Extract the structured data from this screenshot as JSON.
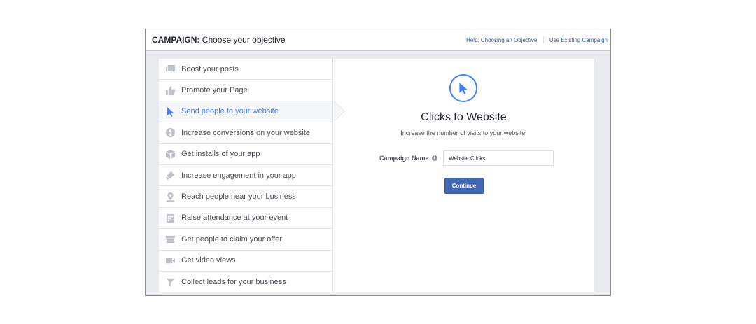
{
  "header": {
    "title_prefix": "CAMPAIGN:",
    "title_text": "Choose your objective",
    "help_link": "Help: Choosing an Objective",
    "existing_link": "Use Existing Campaign"
  },
  "objectives": [
    {
      "label": "Boost your posts",
      "icon": "posts-icon"
    },
    {
      "label": "Promote your Page",
      "icon": "thumbs-up-icon"
    },
    {
      "label": "Send people to your website",
      "icon": "cursor-icon",
      "selected": true
    },
    {
      "label": "Increase conversions on your website",
      "icon": "globe-icon"
    },
    {
      "label": "Get installs of your app",
      "icon": "box-icon"
    },
    {
      "label": "Increase engagement in your app",
      "icon": "gamepad-icon"
    },
    {
      "label": "Reach people near your business",
      "icon": "location-pin-icon"
    },
    {
      "label": "Raise attendance at your event",
      "icon": "calendar-icon"
    },
    {
      "label": "Get people to claim your offer",
      "icon": "offer-icon"
    },
    {
      "label": "Get video views",
      "icon": "video-camera-icon"
    },
    {
      "label": "Collect leads for your business",
      "icon": "funnel-icon"
    }
  ],
  "detail": {
    "icon": "cursor-icon",
    "title": "Clicks to Website",
    "description": "Increase the number of visits to your website.",
    "campaign_name_label": "Campaign Name",
    "campaign_name_value": "Website Clicks",
    "continue_label": "Continue"
  },
  "colors": {
    "accent": "#4080ff",
    "button": "#4267b2",
    "link": "#365899"
  }
}
